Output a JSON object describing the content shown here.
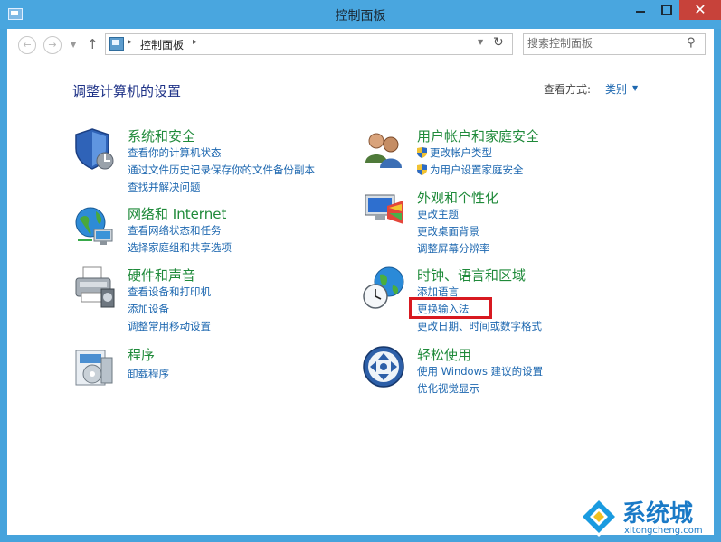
{
  "window": {
    "title": "控制面板",
    "close_glyph": "✕"
  },
  "nav": {
    "back_glyph": "←",
    "forward_glyph": "→",
    "history_glyph": "▼",
    "up_glyph": "↑",
    "address": {
      "separator": "▸",
      "path": "控制面板",
      "dropdown_glyph": "▼",
      "refresh_glyph": "↻"
    },
    "search": {
      "placeholder": "搜索控制面板",
      "icon_glyph": "⚲"
    }
  },
  "page": {
    "heading": "调整计算机的设置",
    "view_by_label": "查看方式:",
    "view_by_value": "类别",
    "view_by_arrow": "▼"
  },
  "categories": [
    {
      "id": "system-security",
      "title": "系统和安全",
      "links": [
        "查看你的计算机状态",
        "通过文件历史记录保存你的文件备份副本",
        "查找并解决问题"
      ]
    },
    {
      "id": "network-internet",
      "title": "网络和 Internet",
      "links": [
        "查看网络状态和任务",
        "选择家庭组和共享选项"
      ]
    },
    {
      "id": "hardware-sound",
      "title": "硬件和声音",
      "links": [
        "查看设备和打印机",
        "添加设备",
        "调整常用移动设置"
      ]
    },
    {
      "id": "programs",
      "title": "程序",
      "links": [
        "卸载程序"
      ]
    },
    {
      "id": "user-accounts",
      "title": "用户帐户和家庭安全",
      "links": [
        "更改帐户类型",
        "为用户设置家庭安全"
      ]
    },
    {
      "id": "appearance",
      "title": "外观和个性化",
      "links": [
        "更改主题",
        "更改桌面背景",
        "调整屏幕分辨率"
      ]
    },
    {
      "id": "clock-language-region",
      "title": "时钟、语言和区域",
      "links": [
        "添加语言",
        "更换输入法",
        "更改日期、时间或数字格式"
      ]
    },
    {
      "id": "ease-of-access",
      "title": "轻松使用",
      "links": [
        "使用 Windows 建议的设置",
        "优化视觉显示"
      ]
    }
  ],
  "watermark": {
    "text": "系统城",
    "url": "xitongcheng.com"
  },
  "colors": {
    "title_green": "#1f8a3a",
    "link_blue": "#1e68b0",
    "heading_blue": "#1e3287",
    "highlight_red": "#d81920",
    "frame_blue": "#46a3dc"
  }
}
